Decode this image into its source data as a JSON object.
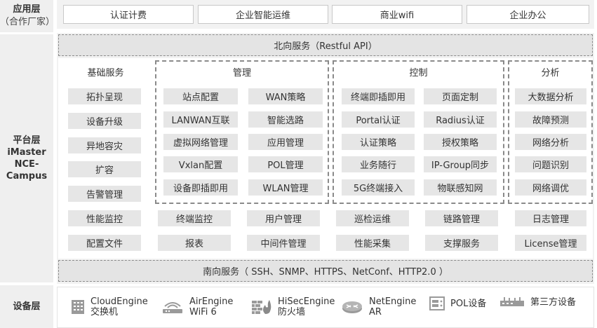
{
  "layers": {
    "app": {
      "title": "应用层",
      "subtitle": "（合作厂家）"
    },
    "platform": {
      "title_lines": [
        "平台层",
        "iMaster",
        "NCE-",
        "Campus"
      ]
    },
    "device": {
      "title": "设备层"
    }
  },
  "app_items": [
    "认证计费",
    "企业智能运维",
    "商业wifi",
    "企业办公"
  ],
  "northbound": "北向服务（Restful API）",
  "southbound": "南向服务（ SSH、SNMP、HTTPS、NetConf、HTTP2.0 ）",
  "categories": {
    "basic": {
      "title": "基础服务",
      "items": [
        "拓扑呈现",
        "设备升级",
        "异地容灾",
        "扩容",
        "告警管理"
      ]
    },
    "manage": {
      "title": "管理",
      "items": [
        "站点配置",
        "WAN策略",
        "LANWAN互联",
        "智能选路",
        "虚拟网络管理",
        "应用管理",
        "Vxlan配置",
        "POL管理",
        "设备即插即用",
        "WLAN管理"
      ]
    },
    "control": {
      "title": "控制",
      "items": [
        "终端即插即用",
        "页面定制",
        "Portal认证",
        "Radius认证",
        "认证策略",
        "授权策略",
        "业务随行",
        "IP-Group同步",
        "5G终端接入",
        "物联感知网"
      ]
    },
    "analysis": {
      "title": "分析",
      "items": [
        "大数据分析",
        "故障预测",
        "网络分析",
        "问题识别",
        "网络调优"
      ]
    }
  },
  "common_rows": [
    [
      "性能监控",
      "终端监控",
      "用户管理",
      "巡检运维",
      "链路管理",
      "日志管理"
    ],
    [
      "配置文件",
      "报表",
      "中间件管理",
      "性能采集",
      "支撑服务",
      "License管理"
    ]
  ],
  "devices": [
    {
      "icon": "switch-icon",
      "lines": [
        "CloudEngine",
        "交换机"
      ]
    },
    {
      "icon": "wifi-ap-icon",
      "lines": [
        "AirEngine",
        "WiFi 6"
      ]
    },
    {
      "icon": "firewall-icon",
      "lines": [
        "HiSecEngine",
        "防火墙"
      ]
    },
    {
      "icon": "router-icon",
      "lines": [
        "NetEngine",
        "AR"
      ]
    },
    {
      "icon": "pol-device-icon",
      "lines": [
        "POL设备"
      ]
    },
    {
      "icon": "third-party-device-icon",
      "lines": [
        "第三方设备"
      ]
    }
  ]
}
